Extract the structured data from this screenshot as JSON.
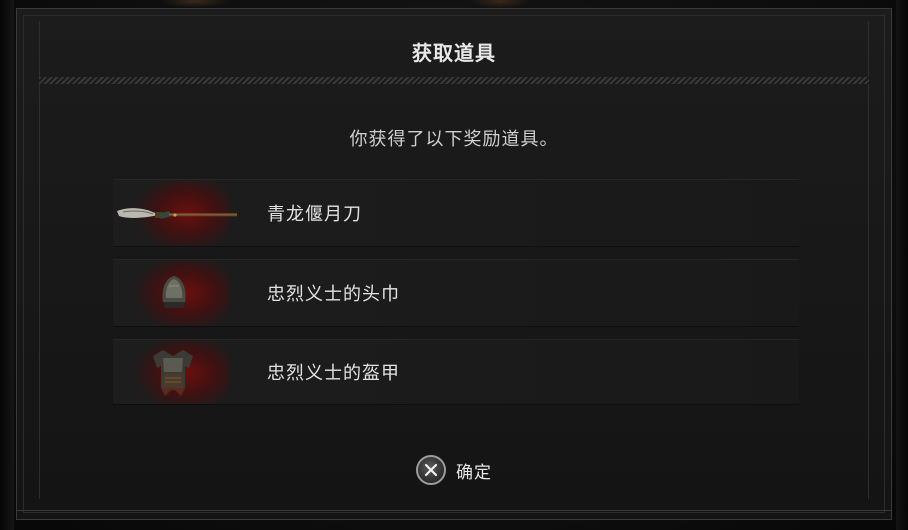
{
  "dialog": {
    "title": "获取道具",
    "subtitle": "你获得了以下奖励道具。"
  },
  "rewards": [
    {
      "name": "青龙偃月刀",
      "icon": "glaive-icon"
    },
    {
      "name": "忠烈义士的头巾",
      "icon": "helmet-icon"
    },
    {
      "name": "忠烈义士的盔甲",
      "icon": "armor-icon"
    }
  ],
  "footer": {
    "confirm_label": "确定",
    "confirm_icon": "cross-button-icon"
  },
  "colors": {
    "aura": "#780c0c",
    "text": "#e2e2e2"
  }
}
